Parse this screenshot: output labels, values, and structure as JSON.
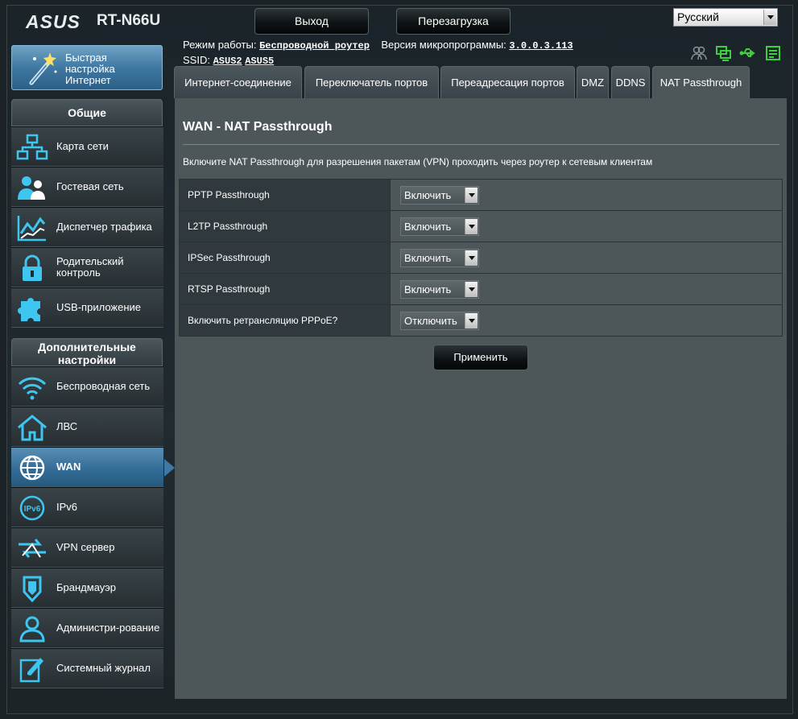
{
  "header": {
    "logo": "ASUS",
    "model": "RT-N66U",
    "logout_label": "Выход",
    "reboot_label": "Перезагрузка",
    "language": "Русский",
    "mode_label": "Режим работы:",
    "mode_value": "Беспроводной роутер",
    "firmware_label": "Версия микропрограммы:",
    "firmware_value": "3.0.0.3.113",
    "ssid_label": "SSID:",
    "ssid_values": [
      "ASUS2",
      "ASUS5"
    ]
  },
  "sidebar": {
    "quick_setup": "Быстрая настройка Интернет",
    "general_header": "Общие",
    "general_items": [
      {
        "label": "Карта сети",
        "icon": "network-map-icon"
      },
      {
        "label": "Гостевая сеть",
        "icon": "guest-network-icon"
      },
      {
        "label": "Диспетчер трафика",
        "icon": "traffic-manager-icon"
      },
      {
        "label": "Родительский контроль",
        "icon": "lock-icon"
      },
      {
        "label": "USB-приложение",
        "icon": "puzzle-icon"
      }
    ],
    "advanced_header": "Дополнительные настройки",
    "advanced_items": [
      {
        "label": "Беспроводная сеть",
        "icon": "wifi-icon"
      },
      {
        "label": "ЛВС",
        "icon": "home-icon"
      },
      {
        "label": "WAN",
        "icon": "globe-icon"
      },
      {
        "label": "IPv6",
        "icon": "ipv6-icon"
      },
      {
        "label": "VPN сервер",
        "icon": "vpn-icon"
      },
      {
        "label": "Брандмауэр",
        "icon": "shield-icon"
      },
      {
        "label": "Администри-рование",
        "icon": "admin-icon"
      },
      {
        "label": "Системный журнал",
        "icon": "log-icon"
      }
    ],
    "active_item": "WAN"
  },
  "tabs": [
    "Интернет-соединение",
    "Переключатель портов",
    "Переадресация портов",
    "DMZ",
    "DDNS",
    "NAT Passthrough"
  ],
  "active_tab": "NAT Passthrough",
  "main": {
    "title": "WAN - NAT Passthrough",
    "description": "Включите NAT Passthrough для разрешения пакетам (VPN) проходить через роутер к сетевым клиентам",
    "rows": [
      {
        "label": "PPTP Passthrough",
        "value": "Включить"
      },
      {
        "label": "L2TP Passthrough",
        "value": "Включить"
      },
      {
        "label": "IPSec Passthrough",
        "value": "Включить"
      },
      {
        "label": "RTSP Passthrough",
        "value": "Включить"
      },
      {
        "label": "Включить ретрансляцию PPPoE?",
        "value": "Отключить"
      }
    ],
    "apply_label": "Применить"
  },
  "colors": {
    "accent": "#3f78a2",
    "icon_cyan": "#3ec6f0",
    "status_green": "#3ecf3e",
    "content_bg": "#4d5659"
  }
}
